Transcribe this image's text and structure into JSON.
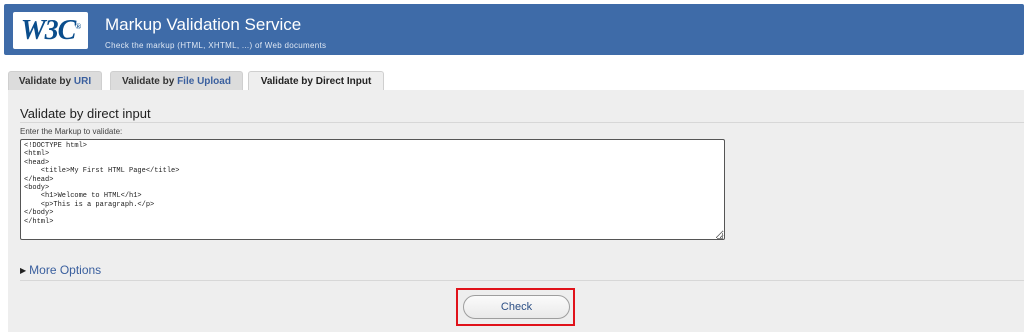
{
  "header": {
    "logo_text": "W3C",
    "logo_reg": "®",
    "title": "Markup Validation Service",
    "subtitle": "Check the markup (HTML, XHTML, ...) of Web documents"
  },
  "tabs": [
    {
      "prefix": "Validate by ",
      "keyword": "URI",
      "active": false
    },
    {
      "prefix": "Validate by ",
      "keyword": "File Upload",
      "active": false
    },
    {
      "prefix": "Validate by ",
      "keyword": "Direct Input",
      "active": true
    }
  ],
  "panel": {
    "title": "Validate by direct input",
    "field_label": "Enter the Markup to validate:",
    "markup_value": "<!DOCTYPE html>\n<html>\n<head>\n    <title>My First HTML Page</title>\n</head>\n<body>\n    <h1>Welcome to HTML</h1>\n    <p>This is a paragraph.</p>\n</body>\n</html>",
    "more_options_label": "More Options",
    "check_label": "Check"
  },
  "colors": {
    "banner": "#3e6ba8",
    "link": "#3a5f9e",
    "highlight": "#e0121a"
  }
}
